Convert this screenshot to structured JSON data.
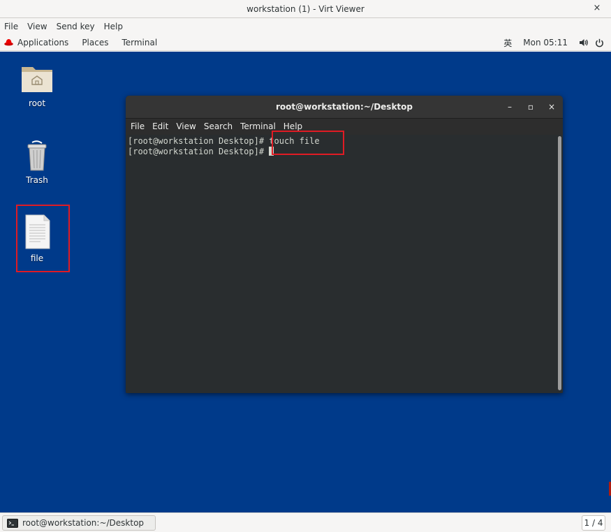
{
  "outer_window": {
    "title": "workstation (1) - Virt Viewer",
    "close_glyph": "×"
  },
  "viewer_menu": [
    "File",
    "View",
    "Send key",
    "Help"
  ],
  "gnome_topbar": {
    "applications": "Applications",
    "places": "Places",
    "terminal": "Terminal",
    "ime": "英",
    "clock": "Mon 05:11"
  },
  "desktop": {
    "background_color": "#003a8a",
    "icons": [
      {
        "label": "root",
        "icon": "home-folder-icon"
      },
      {
        "label": "Trash",
        "icon": "trash-icon"
      },
      {
        "label": "file",
        "icon": "text-file-icon"
      }
    ]
  },
  "terminal": {
    "title": "root@workstation:~/Desktop",
    "controls": {
      "minimize": "–",
      "maximize": "▫",
      "close": "×"
    },
    "menu": [
      "File",
      "Edit",
      "View",
      "Search",
      "Terminal",
      "Help"
    ],
    "lines": [
      {
        "prompt": "[root@workstation Desktop]#",
        "command": " touch file"
      },
      {
        "prompt": "[root@workstation Desktop]#",
        "command": " "
      }
    ]
  },
  "bottom_bar": {
    "task_label": "root@workstation:~/Desktop",
    "workspace": "1 / 4"
  },
  "colors": {
    "highlight": "#e01b24",
    "terminal_bg": "#292d2f"
  }
}
